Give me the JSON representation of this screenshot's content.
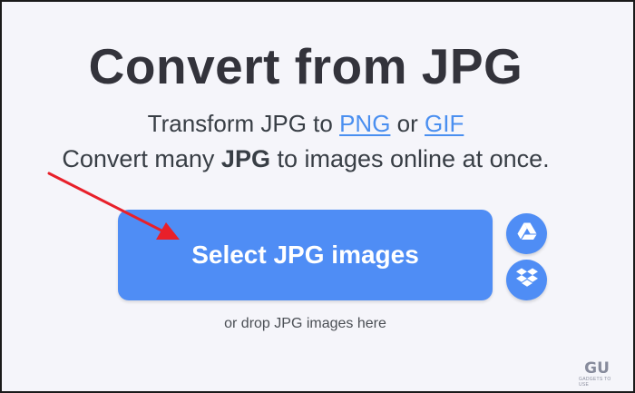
{
  "page": {
    "title": "Convert from JPG",
    "subtitle": {
      "prefix": "Transform JPG to ",
      "link1": "PNG",
      "middle": " or ",
      "link2": "GIF"
    },
    "description": {
      "prefix": "Convert many ",
      "bold": "JPG",
      "suffix": " to images online at once."
    },
    "select_button_label": "Select JPG images",
    "drop_hint": "or drop JPG images here",
    "cloud_buttons": [
      {
        "icon": "google-drive-icon"
      },
      {
        "icon": "dropbox-icon"
      }
    ]
  },
  "watermark": {
    "logo": "GU",
    "text": "GADGETS TO USE"
  },
  "colors": {
    "accent": "#4f8df5",
    "link": "#4a8ff0",
    "title": "#33333b",
    "background": "#f5f5fa",
    "arrow": "#e8202a"
  }
}
